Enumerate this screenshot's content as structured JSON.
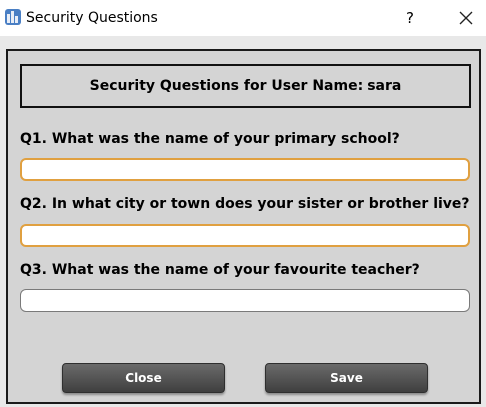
{
  "window": {
    "title": "Security Questions",
    "help_label": "?",
    "icons": {
      "app": "app-icon",
      "close": "close-icon"
    }
  },
  "header": {
    "text": "Security Questions for User Name:",
    "username": "sara"
  },
  "questions": [
    {
      "label": "Q1. What was the name of your primary school?",
      "value": "",
      "border_color": "#e0a040"
    },
    {
      "label": "Q2. In what city or town does your sister or brother live?",
      "value": "",
      "border_color": "#e0a040"
    },
    {
      "label": "Q3. What was the name of your favourite teacher?",
      "value": "",
      "border_color": "#7a7a7a"
    }
  ],
  "buttons": {
    "close_label": "Close",
    "save_label": "Save"
  },
  "colors": {
    "panel_bg": "#d4d4d4",
    "button_bg": "#555555",
    "focus_border": "#e0a040"
  }
}
